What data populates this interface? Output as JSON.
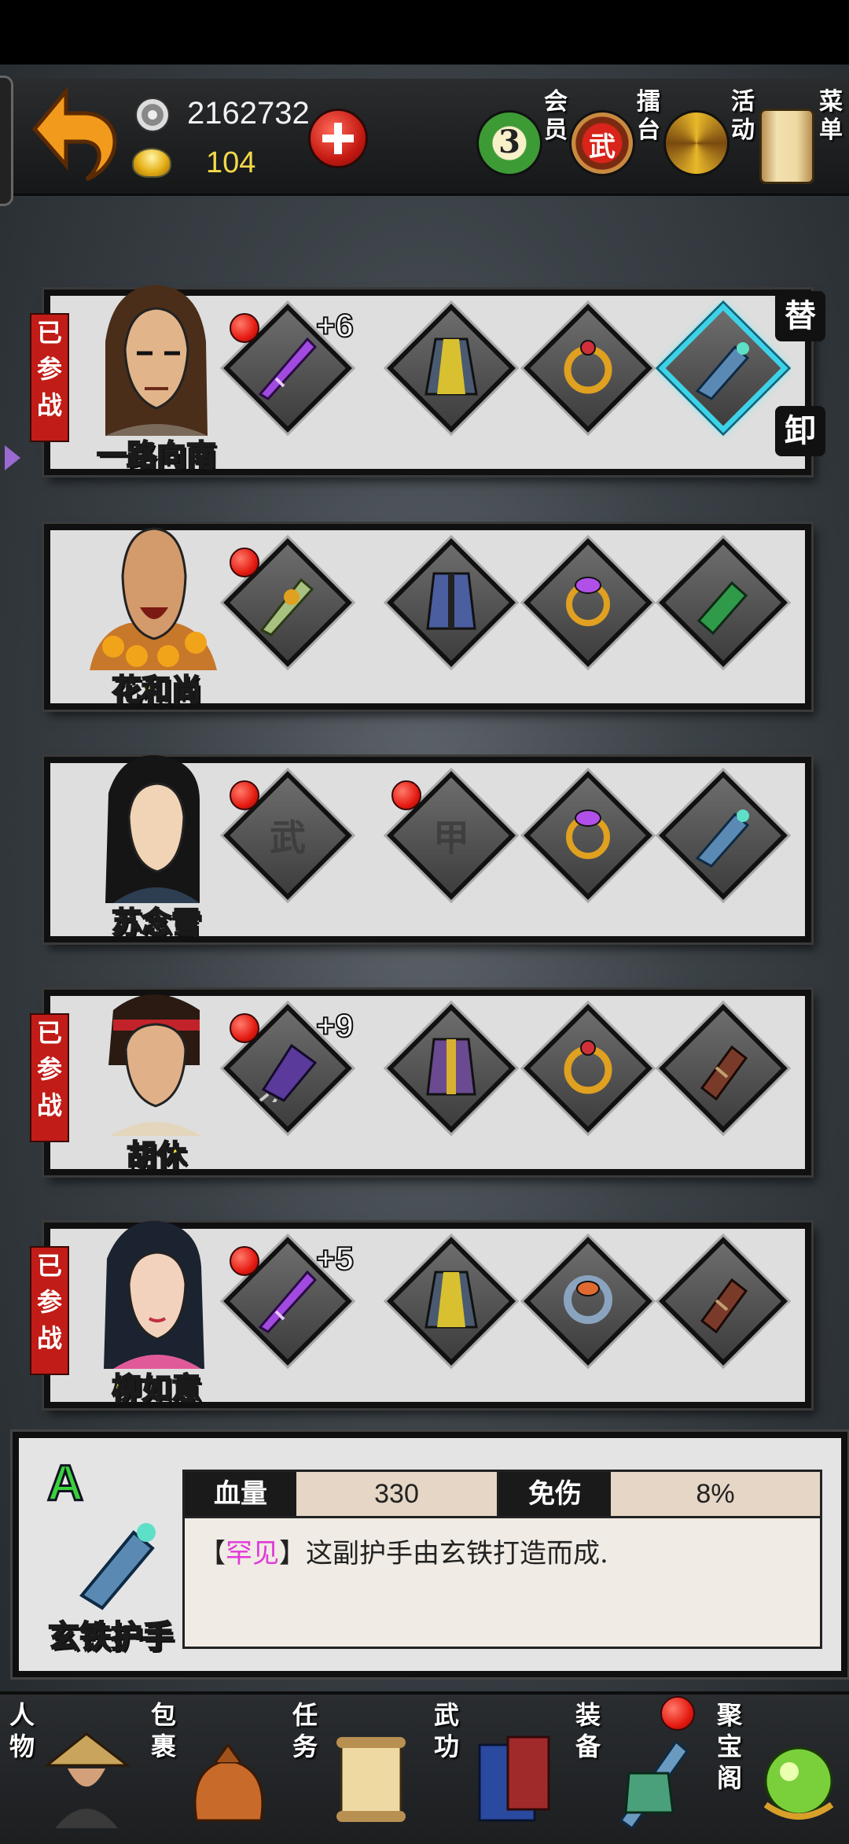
{
  "header": {
    "coins": "2162732",
    "gold": "104",
    "menu": [
      {
        "label": "会员",
        "badge": "3"
      },
      {
        "label": "擂台",
        "emblem": "武"
      },
      {
        "label": "活动"
      },
      {
        "label": "菜单"
      }
    ]
  },
  "heroes": [
    {
      "name": "一路向南",
      "deployed": "已参战",
      "weapon_plus": "+6",
      "swap": "替",
      "unequip": "卸"
    },
    {
      "name": "花和尚"
    },
    {
      "name": "苏念雪",
      "empty_weapon": "武",
      "empty_armor": "甲"
    },
    {
      "name": "胡休",
      "deployed": "已参战",
      "weapon_plus": "+9"
    },
    {
      "name": "柳如意",
      "deployed": "已参战",
      "weapon_plus": "+5"
    }
  ],
  "detail": {
    "grade": "A",
    "item_name": "玄铁护手",
    "stat1_label": "血量",
    "stat1_value": "330",
    "stat2_label": "免伤",
    "stat2_value": "8%",
    "rarity": "罕见",
    "bracket_open": "【",
    "bracket_close": "】",
    "description": "这副护手由玄铁打造而成."
  },
  "nav": [
    {
      "label": "人物"
    },
    {
      "label": "包裹"
    },
    {
      "label": "任务"
    },
    {
      "label": "武功"
    },
    {
      "label": "装备"
    },
    {
      "label": "聚宝阁"
    }
  ],
  "colors": {
    "name_yellow": "#f4e33a",
    "rare_magenta": "#e03ad8",
    "grade_green": "#39d23a",
    "deployed_red": "#c11c17"
  }
}
